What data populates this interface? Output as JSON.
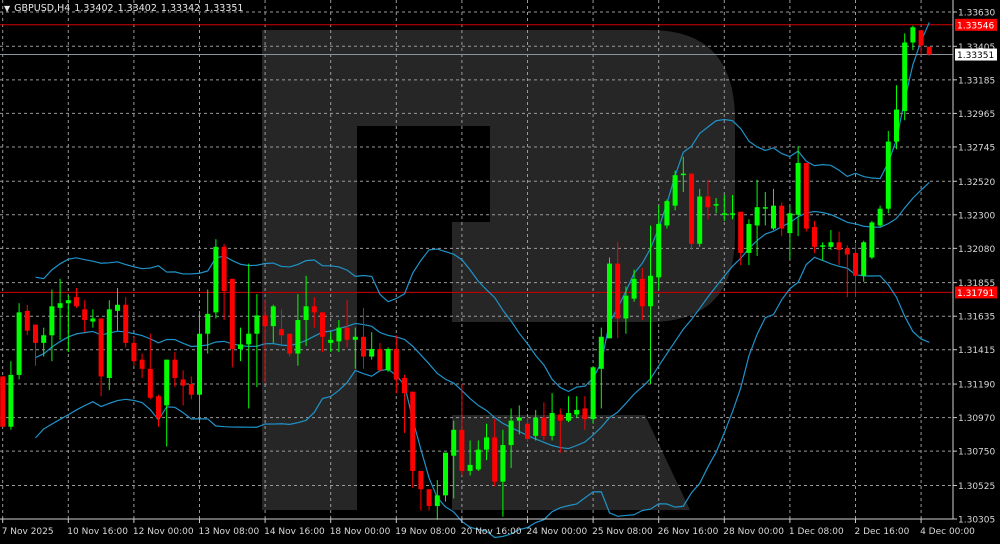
{
  "header": {
    "symbol_timeframe": "GBPUSD,H4",
    "open": "1.33402",
    "high": "1.33402",
    "low": "1.33342",
    "close": "1.33351",
    "menu_icon": "triangle-down-icon"
  },
  "colors": {
    "background": "#000000",
    "grid": "#9a9a9a",
    "bull": "#00ff00",
    "bear": "#ff0000",
    "bands": "#1f93c9",
    "level_line": "#d00000",
    "bid_line": "#8a949c",
    "watermark": "#262626"
  },
  "chart_data": {
    "type": "candlestick",
    "title": "GBPUSD,H4",
    "ylim": [
      1.30305,
      1.3363
    ],
    "y_ticks": [
      "1.33630",
      "1.33405",
      "1.33185",
      "1.32965",
      "1.32745",
      "1.32520",
      "1.32300",
      "1.32080",
      "1.31855",
      "1.31635",
      "1.31415",
      "1.31190",
      "1.30970",
      "1.30750",
      "1.30525",
      "1.30305"
    ],
    "x_ticks": [
      {
        "label": "7 Nov 2025",
        "bar": 0
      },
      {
        "label": "10 Nov 16:00",
        "bar": 8
      },
      {
        "label": "12 Nov 00:00",
        "bar": 16
      },
      {
        "label": "13 Nov 08:00",
        "bar": 24
      },
      {
        "label": "14 Nov 16:00",
        "bar": 32
      },
      {
        "label": "18 Nov 00:00",
        "bar": 40
      },
      {
        "label": "19 Nov 08:00",
        "bar": 48
      },
      {
        "label": "20 Nov 16:00",
        "bar": 56
      },
      {
        "label": "24 Nov 00:00",
        "bar": 64
      },
      {
        "label": "25 Nov 08:00",
        "bar": 72
      },
      {
        "label": "26 Nov 16:00",
        "bar": 80
      },
      {
        "label": "28 Nov 00:00",
        "bar": 88
      },
      {
        "label": "1 Dec 08:00",
        "bar": 96
      },
      {
        "label": "2 Dec 16:00",
        "bar": 104
      },
      {
        "label": "4 Dec 00:00",
        "bar": 112
      }
    ],
    "price_labels": [
      {
        "value": "1.33546",
        "kind": "level"
      },
      {
        "value": "1.33351",
        "kind": "bid"
      },
      {
        "value": "1.31791",
        "kind": "level"
      }
    ],
    "grid": true,
    "ohlc": [
      [
        1.3124,
        1.3124,
        1.3091,
        1.3091
      ],
      [
        1.3091,
        1.3134,
        1.3089,
        1.3125
      ],
      [
        1.3125,
        1.3172,
        1.3122,
        1.3166
      ],
      [
        1.3167,
        1.3171,
        1.3151,
        1.3154
      ],
      [
        1.3158,
        1.3158,
        1.3131,
        1.3146
      ],
      [
        1.3146,
        1.3156,
        1.3137,
        1.3151
      ],
      [
        1.3151,
        1.3181,
        1.3134,
        1.317
      ],
      [
        1.3169,
        1.3188,
        1.3148,
        1.3172
      ],
      [
        1.3172,
        1.3177,
        1.314,
        1.3174
      ],
      [
        1.3176,
        1.3182,
        1.3169,
        1.317
      ],
      [
        1.3168,
        1.3174,
        1.3153,
        1.3161
      ],
      [
        1.316,
        1.3168,
        1.3156,
        1.3162
      ],
      [
        1.3162,
        1.3162,
        1.3111,
        1.3124
      ],
      [
        1.3123,
        1.3174,
        1.3115,
        1.3168
      ],
      [
        1.3167,
        1.3182,
        1.3154,
        1.3171
      ],
      [
        1.3171,
        1.3176,
        1.3143,
        1.3146
      ],
      [
        1.3146,
        1.315,
        1.3131,
        1.3134
      ],
      [
        1.3135,
        1.3139,
        1.3123,
        1.3129
      ],
      [
        1.3129,
        1.3152,
        1.3109,
        1.311
      ],
      [
        1.3111,
        1.3112,
        1.3091,
        1.3097
      ],
      [
        1.3105,
        1.3135,
        1.3078,
        1.3135
      ],
      [
        1.3135,
        1.314,
        1.3117,
        1.3123
      ],
      [
        1.3122,
        1.3128,
        1.3105,
        1.3118
      ],
      [
        1.3119,
        1.3124,
        1.3109,
        1.3112
      ],
      [
        1.3112,
        1.3167,
        1.3095,
        1.3152
      ],
      [
        1.3152,
        1.3181,
        1.3139,
        1.3165
      ],
      [
        1.3166,
        1.3214,
        1.3162,
        1.3209
      ],
      [
        1.3209,
        1.3211,
        1.3161,
        1.318
      ],
      [
        1.3188,
        1.3188,
        1.313,
        1.3142
      ],
      [
        1.3142,
        1.3156,
        1.3134,
        1.3145
      ],
      [
        1.3145,
        1.3198,
        1.3103,
        1.3152
      ],
      [
        1.3152,
        1.3178,
        1.3117,
        1.3164
      ],
      [
        1.3164,
        1.3174,
        1.312,
        1.3157
      ],
      [
        1.3157,
        1.3171,
        1.3146,
        1.317
      ],
      [
        1.3155,
        1.3168,
        1.3145,
        1.3151
      ],
      [
        1.3152,
        1.3152,
        1.3137,
        1.3139
      ],
      [
        1.3139,
        1.3178,
        1.3131,
        1.3161
      ],
      [
        1.3161,
        1.319,
        1.3144,
        1.317
      ],
      [
        1.317,
        1.3176,
        1.3156,
        1.3166
      ],
      [
        1.3166,
        1.3166,
        1.314,
        1.315
      ],
      [
        1.3146,
        1.3153,
        1.314,
        1.3148
      ],
      [
        1.3147,
        1.3161,
        1.314,
        1.3156
      ],
      [
        1.3156,
        1.3174,
        1.3143,
        1.3148
      ],
      [
        1.3148,
        1.3156,
        1.3129,
        1.315
      ],
      [
        1.315,
        1.3169,
        1.3129,
        1.3137
      ],
      [
        1.3137,
        1.3153,
        1.3135,
        1.3142
      ],
      [
        1.3142,
        1.3146,
        1.3127,
        1.3128
      ],
      [
        1.3128,
        1.3143,
        1.3127,
        1.3142
      ],
      [
        1.3142,
        1.3151,
        1.3113,
        1.3122
      ],
      [
        1.3123,
        1.3125,
        1.3087,
        1.3113
      ],
      [
        1.3114,
        1.3114,
        1.3051,
        1.3062
      ],
      [
        1.3062,
        1.3062,
        1.3036,
        1.305
      ],
      [
        1.305,
        1.305,
        1.3036,
        1.3039
      ],
      [
        1.3039,
        1.3056,
        1.303,
        1.3046
      ],
      [
        1.3046,
        1.3074,
        1.3042,
        1.3074
      ],
      [
        1.3072,
        1.3095,
        1.3044,
        1.3089
      ],
      [
        1.3089,
        1.3119,
        1.3059,
        1.3062
      ],
      [
        1.3062,
        1.3082,
        1.3059,
        1.3066
      ],
      [
        1.3063,
        1.3082,
        1.3062,
        1.3076
      ],
      [
        1.3076,
        1.3093,
        1.3069,
        1.3084
      ],
      [
        1.3084,
        1.3096,
        1.3052,
        1.3055
      ],
      [
        1.3055,
        1.3089,
        1.3032,
        1.3079
      ],
      [
        1.3079,
        1.3103,
        1.3064,
        1.3095
      ],
      [
        1.3095,
        1.3105,
        1.3086,
        1.3097
      ],
      [
        1.3093,
        1.3097,
        1.3081,
        1.3083
      ],
      [
        1.3085,
        1.3102,
        1.3082,
        1.3097
      ],
      [
        1.3097,
        1.3107,
        1.3082,
        1.3085
      ],
      [
        1.3085,
        1.3113,
        1.3082,
        1.31
      ],
      [
        1.3099,
        1.3103,
        1.3074,
        1.3095
      ],
      [
        1.3095,
        1.3111,
        1.3094,
        1.31
      ],
      [
        1.3099,
        1.3111,
        1.3097,
        1.3102
      ],
      [
        1.3103,
        1.3111,
        1.3089,
        1.3096
      ],
      [
        1.3096,
        1.313,
        1.3093,
        1.313
      ],
      [
        1.3129,
        1.3156,
        1.3103,
        1.315
      ],
      [
        1.3149,
        1.3202,
        1.3149,
        1.3198
      ],
      [
        1.3198,
        1.3212,
        1.3149,
        1.3162
      ],
      [
        1.3162,
        1.3183,
        1.3152,
        1.3177
      ],
      [
        1.3175,
        1.3194,
        1.3173,
        1.3188
      ],
      [
        1.3188,
        1.3195,
        1.3161,
        1.317
      ],
      [
        1.317,
        1.3223,
        1.3119,
        1.319
      ],
      [
        1.3189,
        1.3236,
        1.3181,
        1.3224
      ],
      [
        1.3223,
        1.324,
        1.3221,
        1.3239
      ],
      [
        1.3236,
        1.3259,
        1.3233,
        1.3256
      ],
      [
        1.3256,
        1.3268,
        1.3245,
        1.3257
      ],
      [
        1.3257,
        1.3257,
        1.3207,
        1.3211
      ],
      [
        1.3211,
        1.3247,
        1.3209,
        1.3242
      ],
      [
        1.3242,
        1.3253,
        1.3227,
        1.3235
      ],
      [
        1.3236,
        1.3241,
        1.3231,
        1.3237
      ],
      [
        1.323,
        1.3243,
        1.3226,
        1.3231
      ],
      [
        1.323,
        1.3243,
        1.3227,
        1.3231
      ],
      [
        1.3232,
        1.3232,
        1.3197,
        1.3205
      ],
      [
        1.3205,
        1.3227,
        1.3197,
        1.3224
      ],
      [
        1.3223,
        1.3253,
        1.3203,
        1.3235
      ],
      [
        1.3234,
        1.3245,
        1.3223,
        1.3235
      ],
      [
        1.3221,
        1.3247,
        1.322,
        1.3236
      ],
      [
        1.3236,
        1.3238,
        1.3216,
        1.3221
      ],
      [
        1.3218,
        1.3236,
        1.3201,
        1.3231
      ],
      [
        1.323,
        1.3275,
        1.3216,
        1.3264
      ],
      [
        1.3264,
        1.3264,
        1.3219,
        1.3221
      ],
      [
        1.3222,
        1.3226,
        1.3205,
        1.3209
      ],
      [
        1.3209,
        1.3212,
        1.32,
        1.321
      ],
      [
        1.3209,
        1.322,
        1.3207,
        1.3212
      ],
      [
        1.3212,
        1.3219,
        1.3197,
        1.3207
      ],
      [
        1.3208,
        1.321,
        1.3176,
        1.3204
      ],
      [
        1.3205,
        1.3211,
        1.3176,
        1.319
      ],
      [
        1.319,
        1.3213,
        1.3186,
        1.3212
      ],
      [
        1.3202,
        1.3226,
        1.3201,
        1.3225
      ],
      [
        1.3223,
        1.3236,
        1.3222,
        1.3234
      ],
      [
        1.3234,
        1.3285,
        1.3231,
        1.3278
      ],
      [
        1.3278,
        1.3315,
        1.3273,
        1.3299
      ],
      [
        1.3298,
        1.3349,
        1.3292,
        1.3343
      ],
      [
        1.3343,
        1.3354,
        1.3338,
        1.3353
      ],
      [
        1.3351,
        1.3351,
        1.3335,
        1.3341
      ],
      [
        1.33402,
        1.33402,
        1.33342,
        1.33351
      ]
    ]
  }
}
